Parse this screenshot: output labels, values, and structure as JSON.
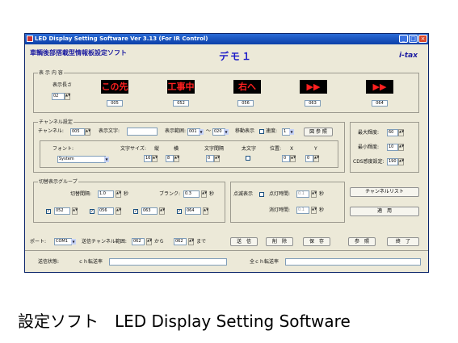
{
  "window": {
    "title": "LED Display Setting Software Ver 3.13 (For IR Control)",
    "header_jp": "車輌後部搭載型情報板設定ソフト",
    "demo_label": "デモ１",
    "logo": "i-tax"
  },
  "display_contents": {
    "group_label": "表 示 内 容",
    "length_label": "表示長さ",
    "length_value": "02",
    "panels": [
      {
        "text": "この先",
        "number": "005"
      },
      {
        "text": "工事中",
        "number": "052"
      },
      {
        "text": "右へ",
        "number": "056"
      },
      {
        "text": "▶▶",
        "number": "063"
      },
      {
        "text": "▶▶",
        "number": "064"
      }
    ]
  },
  "channel_settings": {
    "group_label": "チャンネル設定",
    "channel_label": "チャンネル:",
    "channel_value": "005",
    "text_label": "表示文字:",
    "text_value": "",
    "range_label": "表示範囲:",
    "range_from": "001",
    "range_sep": "〜",
    "range_to": "020",
    "move_label": "移動表示",
    "speed_label": "速度:",
    "speed_value": "1",
    "ref_button": "図 参 照",
    "font_label": "フォント:",
    "font_value": "System",
    "size_label": "文字サイズ:",
    "size_v_label": "縦",
    "size_h_label": "横",
    "size_v_value": "16",
    "size_h_value": "8",
    "spacing_label": "文字間隔",
    "spacing_value": "0",
    "bold_label": "太文字",
    "pos_label": "位置:",
    "pos_x_label": "X",
    "pos_y_label": "Y",
    "pos_x_value": "0",
    "pos_y_value": "0"
  },
  "brightness": {
    "max_label": "最大輝度:",
    "max_value": "60",
    "min_label": "最小輝度:",
    "min_value": "10",
    "cds_label": "CDS感度設定:",
    "cds_value": "190"
  },
  "switch_group": {
    "group_label": "切替表示グループ",
    "interval_label": "切替間隔:",
    "interval_value": "1.0",
    "interval_unit": "秒",
    "blank_label": "ブランク:",
    "blank_value": "0.3",
    "blank_unit": "秒",
    "items": [
      "052",
      "056",
      "063",
      "064"
    ]
  },
  "blink": {
    "blink_label": "点滅表示",
    "on_label": "点灯時間:",
    "on_value": "0.1",
    "on_unit": "秒",
    "off_label": "消灯時間:",
    "off_value": "0.1",
    "off_unit": "秒"
  },
  "right_buttons": {
    "channel_list": "チャンネルリスト",
    "apply": "適　用"
  },
  "bottom_bar": {
    "port_label": "ポート:",
    "port_value": "COM1",
    "send_range_label": "送信チャンネル範囲:",
    "from_value": "062",
    "from_label": "から",
    "to_value": "062",
    "to_label": "まで",
    "buttons": [
      "送　信",
      "削　除",
      "保　存",
      "参　照",
      "終　了"
    ]
  },
  "status_bar": {
    "send_status_label": "送信状態:",
    "ch_rate_label": "ｃｈ転送率",
    "all_ch_rate_label": "全ｃｈ転送率"
  },
  "caption": "設定ソフト　LED Display Setting Software"
}
